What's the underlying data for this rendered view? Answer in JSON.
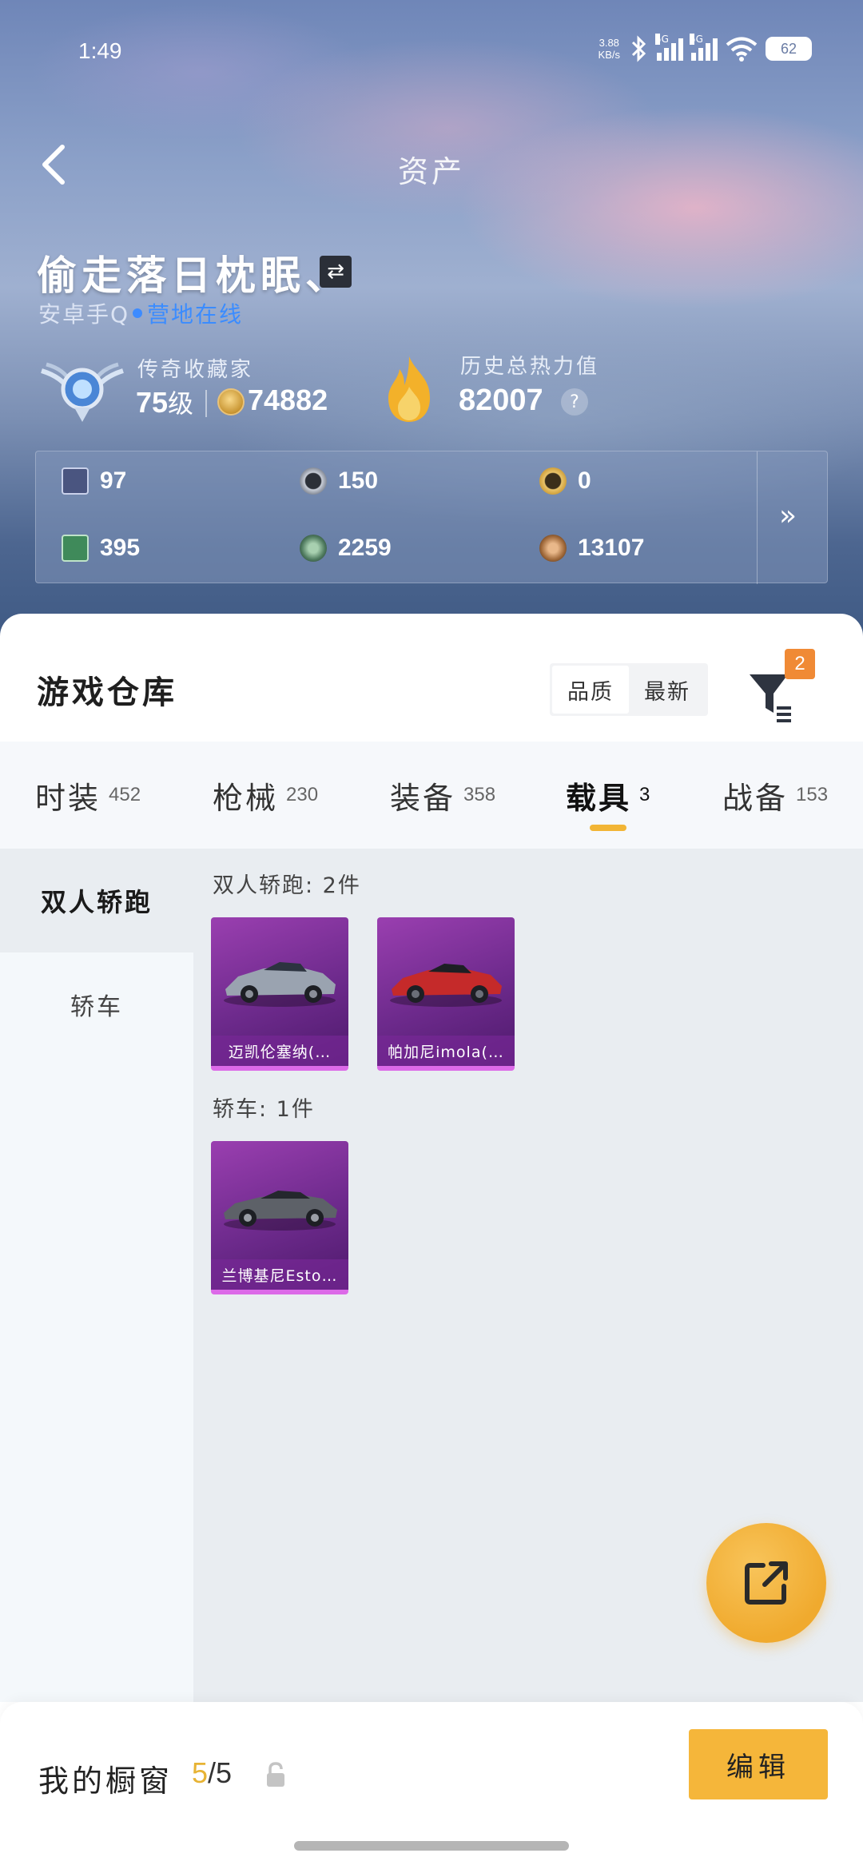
{
  "status_bar": {
    "time": "1:49",
    "net_speed_value": "3.88",
    "net_speed_unit": "KB/s",
    "signal1_tag": "5G",
    "signal2_tag": "5G",
    "wifi_tag": "6",
    "battery": "62"
  },
  "nav": {
    "title": "资产"
  },
  "profile": {
    "name": "偷走落日枕眠、",
    "server": "安卓手Q",
    "online_status": "营地在线",
    "rank_title": "传奇收藏家",
    "level_value": "75",
    "level_unit": "级",
    "coins": "74882",
    "heat_title": "历史总热力值",
    "heat_value": "82007",
    "help_symbol": "?"
  },
  "assets": [
    {
      "icon": "card-icon",
      "value": "97",
      "color": "#4a5580"
    },
    {
      "icon": "silver-coin-icon",
      "value": "150",
      "color": "#6b7280"
    },
    {
      "icon": "gold-emblem-icon",
      "value": "0",
      "color": "#c5922b"
    },
    {
      "icon": "green-card-icon",
      "value": "395",
      "color": "#3f8a5a"
    },
    {
      "icon": "green-coin-icon",
      "value": "2259",
      "color": "#4e7a5e"
    },
    {
      "icon": "bronze-coin-icon",
      "value": "13107",
      "color": "#a0693a"
    }
  ],
  "assets_more": "»",
  "warehouse": {
    "title": "游戏仓库",
    "sort_options": [
      "品质",
      "最新"
    ],
    "filter_badge": "2"
  },
  "tabs": [
    {
      "label": "时装",
      "count": "452"
    },
    {
      "label": "枪械",
      "count": "230"
    },
    {
      "label": "装备",
      "count": "358"
    },
    {
      "label": "载具",
      "count": "3"
    },
    {
      "label": "战备",
      "count": "153"
    }
  ],
  "side_categories": [
    "双人轿跑",
    "轿车"
  ],
  "groups": [
    {
      "label": "双人轿跑: 2件",
      "items": [
        {
          "name": "迈凯伦塞纳(…",
          "car_color": "#9aa3b0",
          "icon": "mclaren-senna-car-icon"
        },
        {
          "name": "帕加尼imola(…",
          "car_color": "#c52a2a",
          "icon": "pagani-imola-car-icon"
        }
      ]
    },
    {
      "label": "轿车: 1件",
      "items": [
        {
          "name": "兰博基尼Esto…",
          "car_color": "#5d6168",
          "icon": "lamborghini-estoque-car-icon"
        }
      ]
    }
  ],
  "showcase": {
    "label": "我的橱窗",
    "current": "5",
    "total": "/5",
    "edit_label": "编辑"
  },
  "colors": {
    "accent": "#f5b63a",
    "card_purple": "#6d2a8c",
    "online_blue": "#3b8cff"
  }
}
